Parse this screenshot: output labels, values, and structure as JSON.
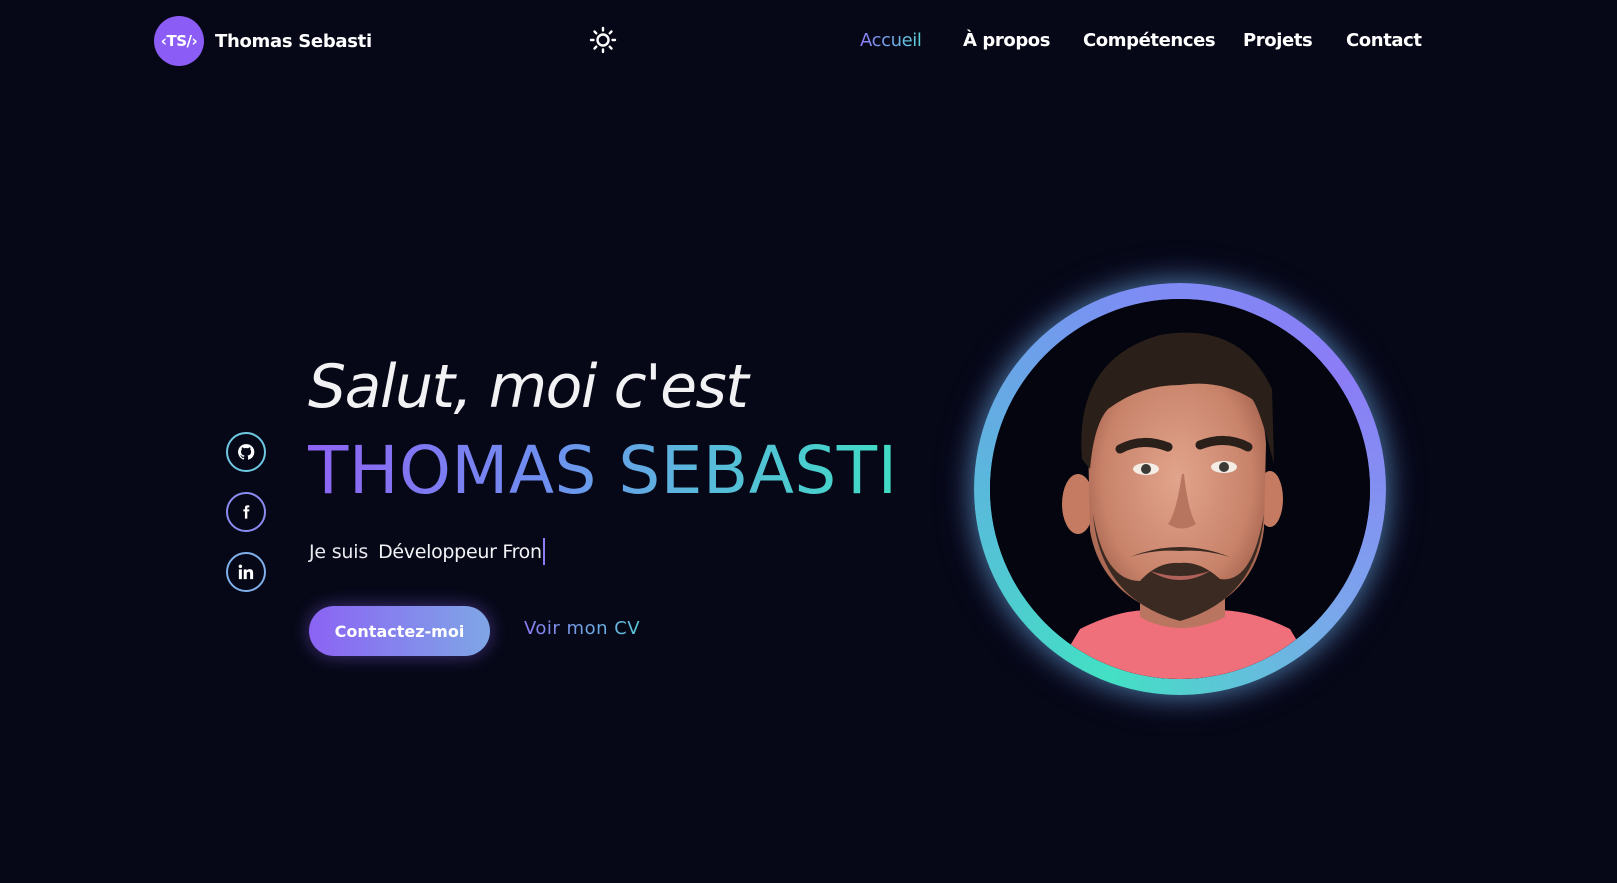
{
  "header": {
    "logo_badge": "‹TS/›",
    "logo_name": "Thomas Sebasti",
    "theme_icon": "sun-icon",
    "nav": [
      {
        "label": "Accueil",
        "active": true
      },
      {
        "label": "À propos",
        "active": false
      },
      {
        "label": "Compétences",
        "active": false
      },
      {
        "label": "Projets",
        "active": false
      },
      {
        "label": "Contact",
        "active": false
      }
    ]
  },
  "socials": [
    {
      "icon": "github-icon"
    },
    {
      "icon": "facebook-icon"
    },
    {
      "icon": "linkedin-icon"
    }
  ],
  "hero": {
    "greeting": "Salut, moi c'est",
    "name": "THOMAS SEBASTI",
    "role_prefix": "Je suis",
    "role_typed": "Développeur Fron",
    "contact_button": "Contactez-moi",
    "cv_link": "Voir mon CV"
  },
  "colors": {
    "background": "#060817",
    "accent_purple": "#8b5cf6",
    "accent_teal": "#43e0c4"
  }
}
